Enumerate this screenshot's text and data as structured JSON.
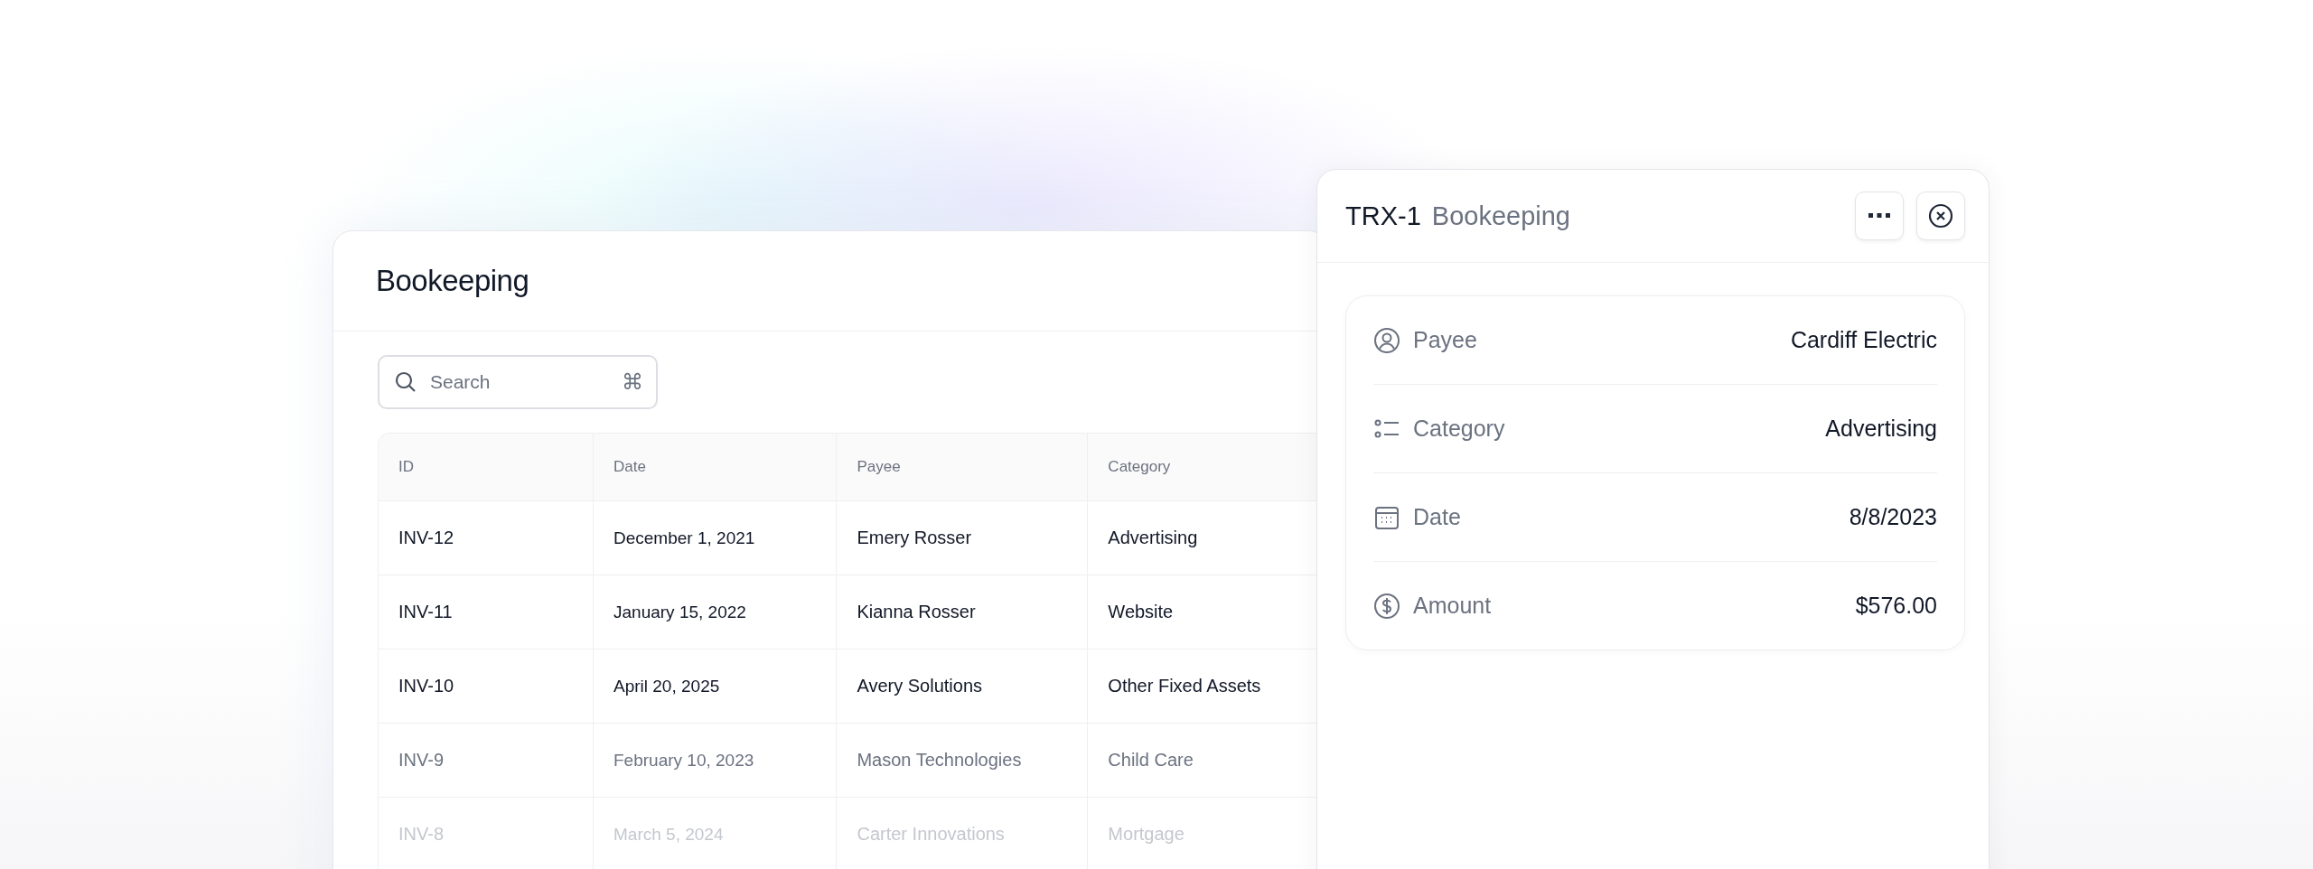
{
  "table_card": {
    "title": "Bookeeping",
    "search": {
      "placeholder": "Search",
      "shortcut": "⌘"
    },
    "columns": [
      "ID",
      "Date",
      "Payee",
      "Category"
    ],
    "rows": [
      {
        "cells": [
          "INV-12",
          "December 1, 2021",
          "Emery Rosser",
          "Advertising"
        ],
        "kind": "normal"
      },
      {
        "cells": [
          "INV-11",
          "January 15, 2022",
          "Kianna Rosser",
          "Website"
        ],
        "kind": "normal"
      },
      {
        "cells": [
          "INV-10",
          "April 20, 2025",
          "Avery Solutions",
          "Other Fixed Assets"
        ],
        "kind": "normal"
      },
      {
        "cells": [
          "INV-9",
          "February 10, 2023",
          "Mason Technologies",
          "Child Care"
        ],
        "kind": "muted"
      },
      {
        "cells": [
          "INV-8",
          "March 5, 2024",
          "Carter Innovations",
          "Mortgage"
        ],
        "kind": "faint"
      }
    ]
  },
  "detail_panel": {
    "id": "TRX-1",
    "subtitle": "Bookeeping",
    "fields": [
      {
        "kind": "person",
        "label": "Payee",
        "value": "Cardiff Electric"
      },
      {
        "kind": "list",
        "label": "Category",
        "value": "Advertising"
      },
      {
        "kind": "calendar",
        "label": "Date",
        "value": "8/8/2023"
      },
      {
        "kind": "money",
        "label": "Amount",
        "value": "$576.00"
      }
    ]
  }
}
